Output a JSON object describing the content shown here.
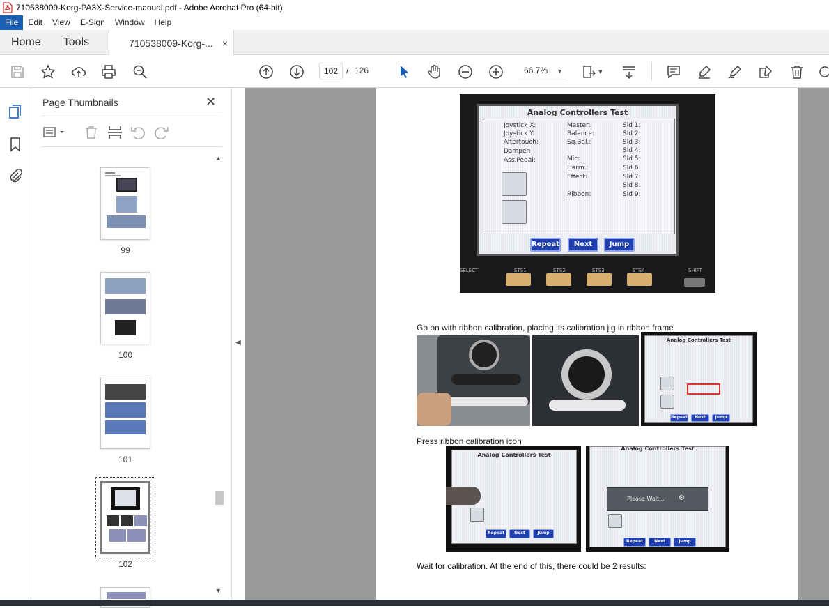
{
  "window": {
    "title": "710538009-Korg-PA3X-Service-manual.pdf - Adobe Acrobat Pro (64-bit)"
  },
  "menu": [
    "File",
    "Edit",
    "View",
    "E-Sign",
    "Window",
    "Help"
  ],
  "tabs": {
    "home": "Home",
    "tools": "Tools",
    "document": "710538009-Korg-...",
    "close": "×"
  },
  "toolbar": {
    "page_current": "102",
    "page_separator": "/",
    "page_total": "126",
    "zoom": "66.7%",
    "icons": [
      "save-icon",
      "bookmark-star-icon",
      "share-upload-icon",
      "print-icon",
      "find-icon",
      "prev-page-icon",
      "next-page-icon",
      "select-cursor-icon",
      "hand-icon",
      "zoom-out-icon",
      "zoom-in-icon",
      "fit-page-icon",
      "scroll-mode-icon",
      "comment-icon",
      "highlight-icon",
      "sign-icon",
      "edit-icon",
      "delete-icon",
      "rotate-icon"
    ]
  },
  "thumbnails_panel": {
    "title": "Page Thumbnails",
    "close": "✕",
    "pages": [
      {
        "label": "99"
      },
      {
        "label": "100"
      },
      {
        "label": "101"
      },
      {
        "label": "102"
      }
    ]
  },
  "document": {
    "caption_1": "Go on with ribbon calibration, placing its calibration jig in ribbon frame",
    "caption_2": "Press ribbon calibration icon",
    "caption_3": "Wait for calibration. At the end of this, there could be 2 results:",
    "screen": {
      "title": "Analog Controllers Test",
      "col1": [
        "Joystick X:",
        "Joystick Y:",
        "Aftertouch:",
        "Damper:",
        "Ass.Pedal:"
      ],
      "col2": [
        "Master:",
        "Balance:",
        "Sq.Bal.:",
        "Mic:",
        "Harm.:",
        "Effect:",
        "Ribbon:"
      ],
      "col3": [
        "Sld 1:",
        "Sld 2:",
        "Sld 3:",
        "Sld 4:",
        "Sld 5:",
        "Sld 6:",
        "Sld 7:",
        "Sld 8:",
        "Sld 9:"
      ],
      "buttons": [
        "Repeat",
        "Next",
        "Jump"
      ],
      "physical_buttons": [
        "STS1",
        "STS2",
        "STS3",
        "STS4",
        "SHIFT"
      ],
      "select_label": "SELECT",
      "please_wait": "Please Wait..."
    }
  },
  "colors": {
    "menu_active": "#1a5fb4",
    "lcd_button": "#1f3fb0",
    "doc_background": "#9a9a9a"
  }
}
